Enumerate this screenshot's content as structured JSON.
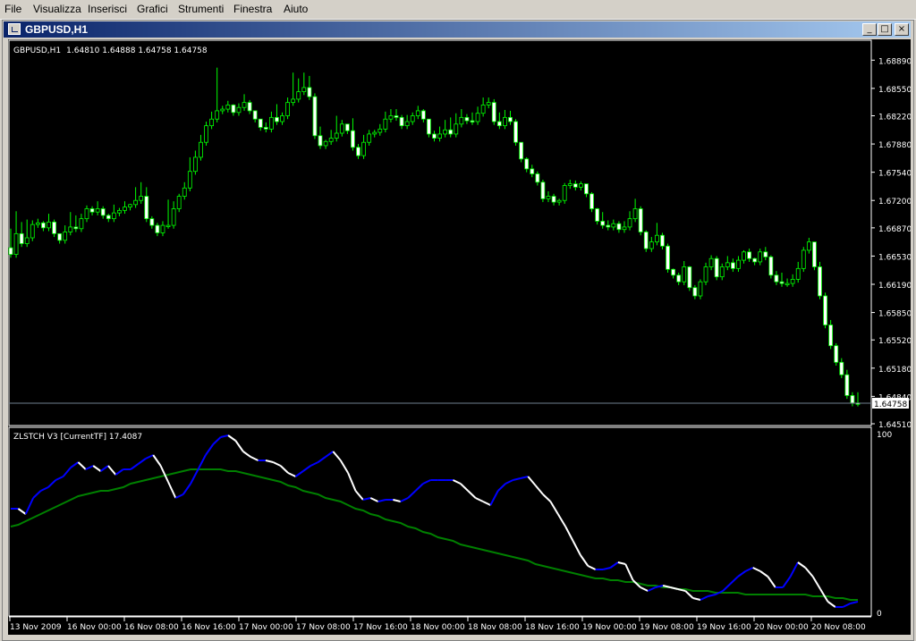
{
  "menu": [
    "File",
    "Visualizza",
    "Inserisci",
    "Grafici",
    "Strumenti",
    "Finestra",
    "Aiuto"
  ],
  "window": {
    "title": "GBPUSD,H1",
    "buttons": {
      "minimize": "_",
      "restore": "□",
      "close": "×"
    }
  },
  "colors": {
    "background": "#000000",
    "bull_body": "#000000",
    "bear_body": "#ffffff",
    "wick": "#00ff00",
    "axis_text": "#ffffff",
    "zlstch_rising": "#0000ff",
    "zlstch_falling": "#ffffff",
    "signal": "#008000",
    "price_line": "#708090"
  },
  "chart_data": [
    {
      "type": "candlestick",
      "symbol_label": "GBPUSD,H1",
      "ohlc_label": "1.64810 1.64888 1.64758 1.64758",
      "current_price": 1.64758,
      "current_price_label": "1.64758",
      "yticks": [
        "1.68890",
        "1.68550",
        "1.68220",
        "1.67880",
        "1.67540",
        "1.67200",
        "1.66870",
        "1.66530",
        "1.66190",
        "1.65850",
        "1.65520",
        "1.65180",
        "1.64840",
        "1.64510"
      ],
      "ylim": [
        1.6451,
        1.6899
      ],
      "xticks": [
        "13 Nov 2009",
        "16 Nov 00:00",
        "16 Nov 08:00",
        "16 Nov 16:00",
        "17 Nov 00:00",
        "17 Nov 08:00",
        "17 Nov 16:00",
        "18 Nov 00:00",
        "18 Nov 08:00",
        "18 Nov 16:00",
        "19 Nov 00:00",
        "19 Nov 08:00",
        "19 Nov 16:00",
        "20 Nov 00:00",
        "20 Nov 08:00"
      ],
      "close": [
        1.6655,
        1.668,
        1.6668,
        1.6675,
        1.6691,
        1.6693,
        1.6687,
        1.6694,
        1.668,
        1.6672,
        1.6682,
        1.6688,
        1.6686,
        1.6698,
        1.671,
        1.6706,
        1.671,
        1.6702,
        1.6698,
        1.6705,
        1.6708,
        1.6712,
        1.6715,
        1.672,
        1.6725,
        1.6698,
        1.669,
        1.6681,
        1.669,
        1.669,
        1.671,
        1.6725,
        1.6735,
        1.6755,
        1.6772,
        1.679,
        1.681,
        1.6818,
        1.6828,
        1.683,
        1.6835,
        1.6826,
        1.6832,
        1.6838,
        1.6828,
        1.6818,
        1.6808,
        1.6806,
        1.682,
        1.6815,
        1.6822,
        1.6838,
        1.6842,
        1.6851,
        1.6856,
        1.6845,
        1.6798,
        1.6786,
        1.6791,
        1.6795,
        1.6801,
        1.6812,
        1.6804,
        1.6784,
        1.6774,
        1.679,
        1.68,
        1.6802,
        1.6806,
        1.6818,
        1.6822,
        1.682,
        1.681,
        1.6815,
        1.6822,
        1.6828,
        1.6818,
        1.68,
        1.6795,
        1.68,
        1.6805,
        1.68,
        1.6812,
        1.682,
        1.6816,
        1.6815,
        1.6825,
        1.6835,
        1.6838,
        1.6815,
        1.681,
        1.682,
        1.6815,
        1.679,
        1.677,
        1.6758,
        1.6752,
        1.6742,
        1.6722,
        1.6725,
        1.6718,
        1.672,
        1.6738,
        1.674,
        1.6736,
        1.674,
        1.6728,
        1.671,
        1.6695,
        1.669,
        1.6688,
        1.6692,
        1.6685,
        1.6688,
        1.6698,
        1.671,
        1.6682,
        1.6662,
        1.667,
        1.6678,
        1.6665,
        1.6637,
        1.663,
        1.6622,
        1.664,
        1.6615,
        1.6605,
        1.6622,
        1.664,
        1.665,
        1.6628,
        1.664,
        1.6645,
        1.6638,
        1.6648,
        1.6658,
        1.665,
        1.6646,
        1.6658,
        1.6652,
        1.663,
        1.6622,
        1.662,
        1.662,
        1.6625,
        1.6638,
        1.666,
        1.667,
        1.664,
        1.6605,
        1.657,
        1.6545,
        1.6525,
        1.651,
        1.6485,
        1.6476,
        1.64758
      ],
      "range": [
        1.6686,
        1.6707,
        1.6694,
        1.6697,
        1.6696,
        1.6698,
        1.6695,
        1.6704,
        1.6697,
        1.6679,
        1.669,
        1.6706,
        1.6702,
        1.6704,
        1.6714,
        1.6713,
        1.6719,
        1.6713,
        1.6704,
        1.6715,
        1.6711,
        1.6719,
        1.6716,
        1.6736,
        1.6742,
        1.6736,
        1.6701,
        1.6693,
        1.6695,
        1.6721,
        1.6719,
        1.6728,
        1.6742,
        1.6772,
        1.678,
        1.6799,
        1.6815,
        1.6827,
        1.688,
        1.6834,
        1.684,
        1.6836,
        1.6837,
        1.6848,
        1.6841,
        1.6827,
        1.6811,
        1.6814,
        1.6827,
        1.6836,
        1.6826,
        1.6844,
        1.6874,
        1.6867,
        1.6874,
        1.687,
        1.6849,
        1.6809,
        1.6793,
        1.6805,
        1.6822,
        1.6817,
        1.6812,
        1.6819,
        1.6788,
        1.6799,
        1.6805,
        1.6805,
        1.6812,
        1.6827,
        1.683,
        1.683,
        1.6823,
        1.6823,
        1.6826,
        1.6834,
        1.683,
        1.6811,
        1.6804,
        1.6809,
        1.6817,
        1.682,
        1.6825,
        1.683,
        1.6824,
        1.6826,
        1.6833,
        1.6844,
        1.6844,
        1.6842,
        1.6826,
        1.6829,
        1.6828,
        1.6818,
        1.6783,
        1.6772,
        1.6763,
        1.6755,
        1.6745,
        1.6731,
        1.6728,
        1.6722,
        1.6741,
        1.6745,
        1.6744,
        1.6743,
        1.674,
        1.673,
        1.6711,
        1.6706,
        1.6696,
        1.6697,
        1.6695,
        1.6695,
        1.6707,
        1.6722,
        1.6713,
        1.6684,
        1.6676,
        1.6693,
        1.6681,
        1.6668,
        1.6638,
        1.6633,
        1.6647,
        1.6641,
        1.6618,
        1.6625,
        1.6645,
        1.6654,
        1.6653,
        1.6644,
        1.6653,
        1.665,
        1.6653,
        1.666,
        1.6662,
        1.6651,
        1.6662,
        1.6664,
        1.6654,
        1.6635,
        1.6633,
        1.6626,
        1.6631,
        1.6646,
        1.6664,
        1.6675,
        1.667,
        1.6646,
        1.6609,
        1.6576,
        1.6548,
        1.653,
        1.6516,
        1.6489,
        1.6489,
        1.6475,
        1.6464,
        1.647
      ]
    },
    {
      "type": "line",
      "label": "ZLSTCH V3  [CurrentTF]  17.4087",
      "ylim": [
        0,
        100
      ],
      "yticks": [
        "100",
        "0"
      ],
      "series": [
        {
          "values": [
            58,
            58,
            55,
            64,
            68,
            70,
            74,
            76,
            81,
            84,
            80,
            82,
            79,
            82,
            77,
            80,
            80,
            83,
            86,
            88,
            82,
            73,
            64,
            66,
            72,
            80,
            88,
            94,
            98,
            99,
            96,
            90,
            87,
            85,
            85,
            84,
            82,
            78,
            76,
            79,
            82,
            84,
            87,
            90,
            85,
            78,
            68,
            63,
            64,
            62,
            63,
            63,
            62,
            64,
            68,
            72,
            74,
            74,
            74,
            74,
            72,
            68,
            64,
            62,
            60,
            68,
            72,
            74,
            75,
            76,
            71,
            66,
            62,
            55,
            48,
            40,
            32,
            26,
            24,
            24,
            25,
            28,
            27,
            18,
            14,
            12,
            14,
            15,
            14,
            13,
            12,
            8,
            7,
            9,
            10,
            12,
            16,
            20,
            23,
            25,
            23,
            20,
            14,
            14,
            20,
            28,
            25,
            20,
            13,
            6,
            3,
            3,
            5,
            6
          ]
        },
        {
          "values": [
            48,
            49,
            51,
            53,
            55,
            57,
            59,
            61,
            63,
            65,
            66,
            67,
            68,
            68,
            69,
            70,
            72,
            73,
            74,
            75,
            76,
            77,
            78,
            79,
            80,
            80,
            80,
            80,
            80,
            79,
            79,
            78,
            77,
            76,
            75,
            74,
            73,
            71,
            70,
            68,
            67,
            66,
            64,
            63,
            62,
            60,
            58,
            57,
            55,
            54,
            52,
            51,
            50,
            48,
            47,
            45,
            44,
            42,
            41,
            40,
            38,
            37,
            36,
            35,
            34,
            33,
            32,
            31,
            30,
            29,
            27,
            26,
            25,
            24,
            23,
            22,
            21,
            20,
            19,
            19,
            18,
            18,
            17,
            17,
            16,
            15,
            15,
            14,
            14,
            13,
            13,
            12,
            12,
            12,
            11,
            11,
            11,
            11,
            10,
            10,
            10,
            10,
            10,
            10,
            10,
            10,
            10,
            9,
            9,
            9,
            8,
            8,
            7,
            7
          ]
        }
      ]
    }
  ]
}
